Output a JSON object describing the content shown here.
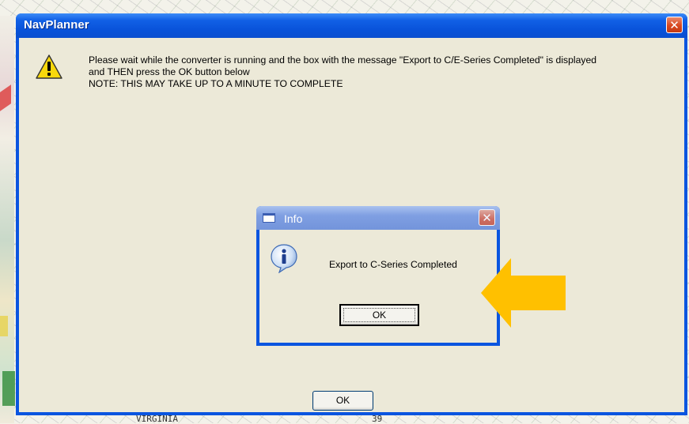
{
  "background_map": {
    "bottom_labels": [
      "VIRGINIA",
      "39"
    ]
  },
  "main_window": {
    "title": "NavPlanner",
    "close_symbol": "✕",
    "message_lines": [
      "Please wait while the converter is running and the box with the message \"Export to C/E-Series Completed\"  is displayed",
      "and THEN press the OK button below",
      "NOTE: THIS MAY TAKE UP TO A MINUTE TO COMPLETE"
    ],
    "ok_label": "OK",
    "icon": "warning-icon"
  },
  "info_dialog": {
    "title": "Info",
    "close_symbol": "✕",
    "message": "Export to C-Series Completed",
    "ok_label": "OK",
    "icon": "information-icon"
  },
  "annotation": {
    "icon": "arrow-left-icon",
    "color": "#ffc000"
  },
  "colors": {
    "titlebar_blue": "#0a55e0",
    "dialog_face": "#ece9d8",
    "close_red": "#d9481f"
  }
}
